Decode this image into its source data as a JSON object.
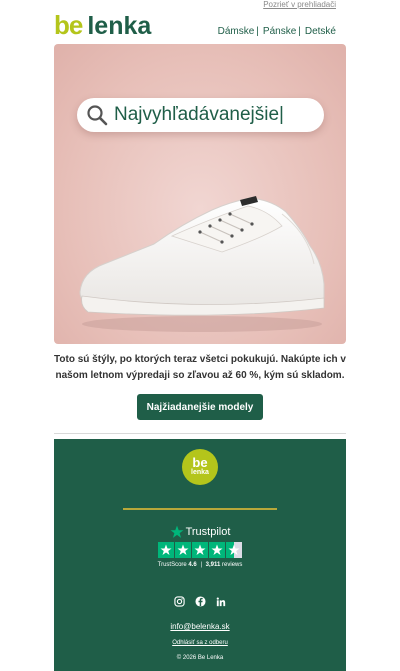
{
  "header": {
    "browser_link": "Pozrieť v prehliadači",
    "logo": {
      "be": "be",
      "lenka": "lenka"
    },
    "nav": [
      {
        "label": "Dámske"
      },
      {
        "label": "Pánske"
      },
      {
        "label": "Detské"
      }
    ],
    "nav_separator": "|"
  },
  "hero": {
    "search_text": "Najvyhľadávanejšie|",
    "icon": "search-icon",
    "image": "white-sneaker"
  },
  "body": {
    "text": "Toto sú štýly, po ktorých teraz všetci pokukujú. Nakúpte ich v našom letnom výpredaji so zľavou až 60 %, kým sú skladom.",
    "cta_label": "Najžiadanejšie modely"
  },
  "footer": {
    "logo": {
      "be": "be",
      "lenka": "lenka"
    },
    "trustpilot": {
      "brand": "Trustpilot",
      "score_label": "TrustScore",
      "score": "4.6",
      "separator": "|",
      "reviews_count": "3,911",
      "reviews_label": "reviews",
      "stars": 4.5
    },
    "socials": [
      {
        "name": "instagram",
        "icon": "instagram-icon"
      },
      {
        "name": "facebook",
        "icon": "facebook-icon"
      },
      {
        "name": "linkedin",
        "icon": "linkedin-icon"
      }
    ],
    "email": "info@belenka.sk",
    "unsubscribe": "Odhlásiť sa z odberu",
    "copyright": "© 2026 Be Lenka"
  },
  "colors": {
    "brand_green": "#1f5e48",
    "brand_lime": "#b4c51b",
    "trustpilot_green": "#00b67a",
    "hero_background": "#e7bfb8"
  }
}
